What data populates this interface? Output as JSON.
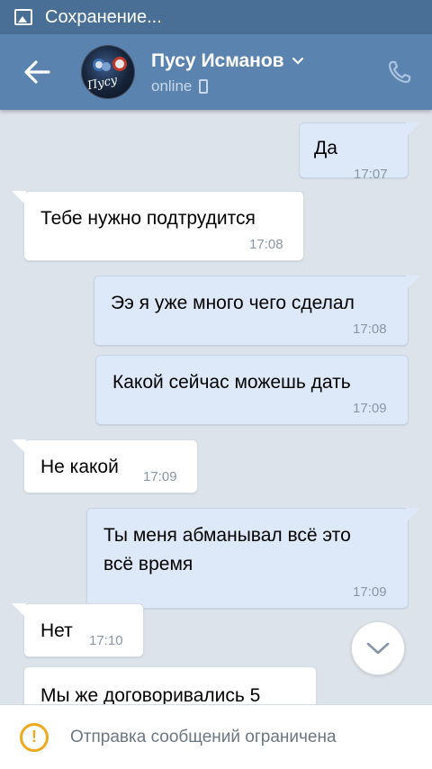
{
  "status_bar": {
    "text": "Сохранение..."
  },
  "header": {
    "name": "Пусу Исманов",
    "status": "online",
    "avatar_text": "Пусу"
  },
  "messages": [
    {
      "dir": "out",
      "text": "Да",
      "time": "17:07"
    },
    {
      "dir": "in",
      "text": "Тебе нужно подтрудится",
      "time": "17:08"
    },
    {
      "dir": "out",
      "text": "Ээ я уже много чего сделал",
      "time": "17:08"
    },
    {
      "dir": "out",
      "text": "Какой сейчас можешь дать",
      "time": "17:09"
    },
    {
      "dir": "in",
      "text": "Не какой",
      "time": "17:09"
    },
    {
      "dir": "out",
      "text": "Ты меня абманывал всё это",
      "text2": "всё время",
      "time": "17:09"
    },
    {
      "dir": "in",
      "text": "Нет",
      "time": "17:10"
    },
    {
      "dir": "in",
      "text": "Мы же договоривались 5",
      "time": ""
    }
  ],
  "footer": {
    "notice": "Отправка сообщений ограничена"
  },
  "colors": {
    "header": "#5b83b0",
    "status_bar": "#4a6f97",
    "outgoing": "#dde9f8",
    "warning": "#f0a81c"
  }
}
